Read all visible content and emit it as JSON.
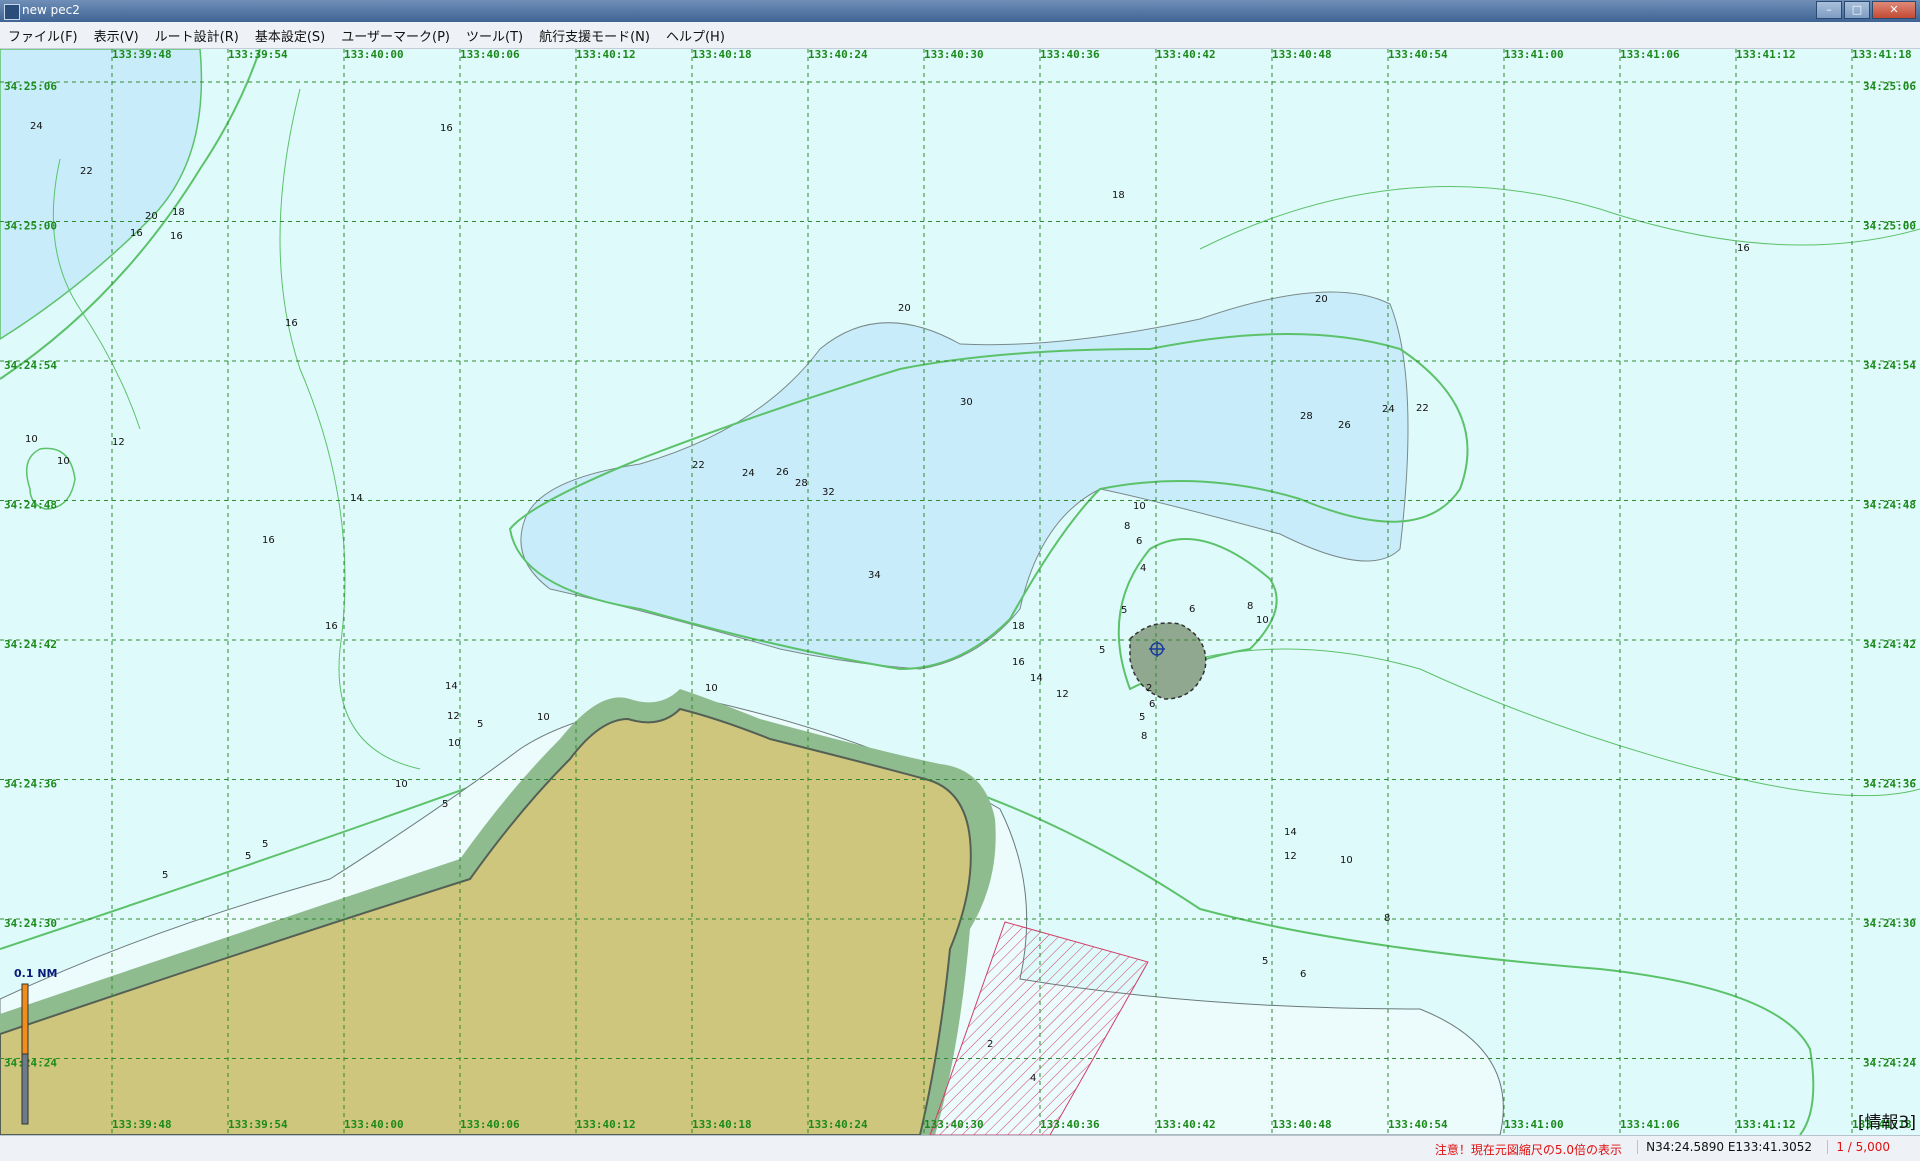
{
  "window": {
    "title": "new pec2",
    "buttons": [
      "–",
      "□",
      "✕"
    ]
  },
  "menu": [
    "ファイル(F)",
    "表示(V)",
    "ルート設計(R)",
    "基本設定(S)",
    "ユーザーマーク(P)",
    "ツール(T)",
    "航行支援モード(N)",
    "ヘルプ(H)"
  ],
  "map": {
    "lon_labels": [
      "133:39:48",
      "133:39:54",
      "133:40:00",
      "133:40:06",
      "133:40:12",
      "133:40:18",
      "133:40:24",
      "133:40:30",
      "133:40:36",
      "133:40:42",
      "133:40:48",
      "133:40:54",
      "133:41:00",
      "133:41:06",
      "133:41:12",
      "133:41:18"
    ],
    "lat_labels": [
      "34:25:06",
      "34:25:00",
      "34:24:54",
      "34:24:48",
      "34:24:42",
      "34:24:36",
      "34:24:30",
      "34:24:24"
    ],
    "depth_soundings": [
      "24",
      "22",
      "20",
      "18",
      "16",
      "16",
      "16",
      "10",
      "10",
      "12",
      "16",
      "14",
      "16",
      "16",
      "14",
      "12",
      "10",
      "10",
      "5",
      "5",
      "5",
      "5",
      "10",
      "5",
      "10",
      "20",
      "30",
      "22",
      "24",
      "26",
      "28",
      "32",
      "34",
      "18",
      "16",
      "14",
      "12",
      "10",
      "8",
      "6",
      "4",
      "5",
      "6",
      "8",
      "10",
      "5",
      "2",
      "6",
      "5",
      "8",
      "18",
      "20",
      "28",
      "26",
      "24",
      "22",
      "16",
      "14",
      "12",
      "10",
      "8",
      "5",
      "6",
      "2",
      "4"
    ],
    "colors": {
      "sea_shallow": "#dffafb",
      "sea_deep": "#c8ecfa",
      "land": "#cfc67e",
      "shore": "#8fbc8f",
      "contour": "#5cc26a",
      "grid": "#2f8a2f",
      "label": "#1a8a1a",
      "hatch": "#d0406a"
    },
    "scalebar_label": "0.1 NM"
  },
  "status": {
    "warning": "注意！現在元図縮尺の5.0倍の表示",
    "coords": "N34:24.5890 E133:41.3052",
    "scale": "1 / 5,000"
  },
  "info_button": "[情報3]"
}
